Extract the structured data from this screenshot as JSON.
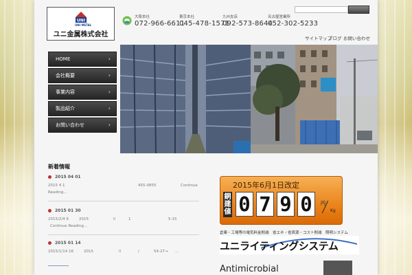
{
  "company": {
    "logo_mark": "UNI",
    "logo_sub": "UNI METAL",
    "name": "ユニ金属株式会社"
  },
  "offices": [
    {
      "name": "大阪本社",
      "tel": "072-966-6611"
    },
    {
      "name": "東京本社",
      "tel": "045-478-1571"
    },
    {
      "name": "九州支店",
      "tel": "092-573-8644"
    },
    {
      "name": "名古屋営業所",
      "tel": "052-302-5233"
    }
  ],
  "top_links": [
    "サイトマップ",
    "ブログ",
    "お問い合わせ"
  ],
  "nav": [
    {
      "label": "HOME"
    },
    {
      "label": "会社概要"
    },
    {
      "label": "事業内容"
    },
    {
      "label": "製品紹介"
    },
    {
      "label": "お問い合わせ"
    }
  ],
  "news": {
    "title": "新着情報",
    "items": [
      {
        "date": "2015 04 01",
        "line1": [
          "2015 4 1",
          "455-0855",
          "Continue"
        ],
        "line2": "Reading..."
      },
      {
        "date": "2015 01 30",
        "line1": [
          "2015/2/4 6",
          "2015",
          "ll",
          "1",
          "5-15"
        ],
        "line2": "Continue Reading..."
      },
      {
        "date": "2015 01 14",
        "line1": [
          "2015/1/14 16",
          "2015",
          "ll",
          "/",
          "54-27→",
          "..."
        ],
        "line2": ""
      }
    ]
  },
  "price_banner": {
    "date": "2015年6月1日改定",
    "label": "銅建値",
    "digits": [
      "0",
      "7",
      "9",
      "0"
    ],
    "unit_top": "円",
    "unit_bottom": "Kg"
  },
  "banner_caption": "倉庫・工場等の電気料金削減　省エネ・省資源・コスト削減　照明システム",
  "lighting_banner": "ユニライティングシステム",
  "antimicrobial": "Antimicrobial",
  "colors": {
    "nav_bg": "#2e2e2e",
    "accent_red": "#c0312a",
    "banner_orange": "#e87d13"
  }
}
